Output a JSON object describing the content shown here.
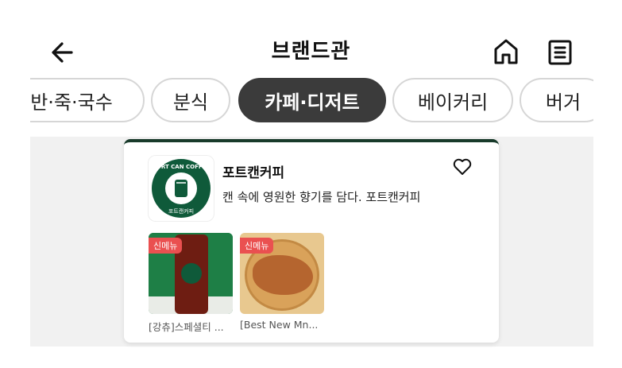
{
  "header": {
    "title": "브랜드관",
    "back_icon": "arrow-left-icon",
    "home_icon": "home-icon",
    "menu_icon": "list-icon"
  },
  "tabs": [
    {
      "label": "반·죽·국수",
      "active": false
    },
    {
      "label": "분식",
      "active": false
    },
    {
      "label": "카페·디저트",
      "active": true
    },
    {
      "label": "베이커리",
      "active": false
    },
    {
      "label": "버거",
      "active": false
    }
  ],
  "brand": {
    "name": "포트캔커피",
    "description": "캔 속에 영원한 향기를 담다. 포트캔커피",
    "logo_text_top": "PORT CAN COFFEE",
    "logo_text_bottom": "포트캔커피",
    "logo_color": "#0f5a3a",
    "favorite_icon": "heart-outline-icon"
  },
  "products": [
    {
      "badge": "신메뉴",
      "name": "[강츄]스페셜티 ..."
    },
    {
      "badge": "신메뉴",
      "name": "[Best New Mn..."
    }
  ]
}
